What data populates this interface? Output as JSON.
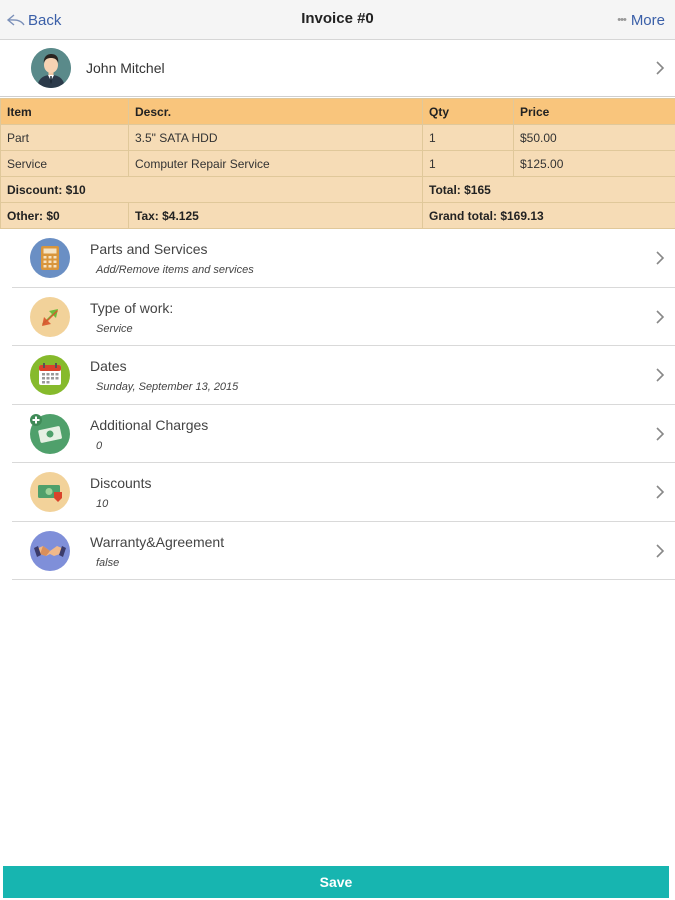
{
  "nav": {
    "back_label": "Back",
    "title": "Invoice #0",
    "more_label": "More"
  },
  "customer": {
    "name": "John Mitchel"
  },
  "invoice_table": {
    "headers": [
      "Item",
      "Descr.",
      "Qty",
      "Price"
    ],
    "rows": [
      [
        "Part",
        "3.5\" SATA HDD",
        "1",
        "$50.00"
      ],
      [
        "Service",
        "Computer Repair Service",
        "1",
        "$125.00"
      ]
    ],
    "discount": "Discount: $10",
    "total": "Total: $165",
    "other": "Other: $0",
    "tax": "Tax: $4.125",
    "grand_total": "Grand total: $169.13",
    "grand_total_color": "#1a3adf"
  },
  "menu": [
    {
      "title": "Parts and Services",
      "subtitle": "Add/Remove items and services",
      "icon": "calculator-icon"
    },
    {
      "title": "Type of work:",
      "subtitle": "Service",
      "icon": "exchange-arrows-icon"
    },
    {
      "title": "Dates",
      "subtitle": "Sunday, September 13, 2015",
      "icon": "calendar-icon"
    },
    {
      "title": "Additional Charges",
      "subtitle": "0",
      "icon": "add-money-icon"
    },
    {
      "title": "Discounts",
      "subtitle": "10",
      "icon": "discount-money-icon"
    },
    {
      "title": "Warranty&Agreement",
      "subtitle": "false",
      "icon": "handshake-icon"
    }
  ],
  "save_label": "Save",
  "colors": {
    "accent": "#17b5b0",
    "table_header": "#f9c57c",
    "table_body": "#f6dcb6",
    "link": "#3a5fa8"
  }
}
